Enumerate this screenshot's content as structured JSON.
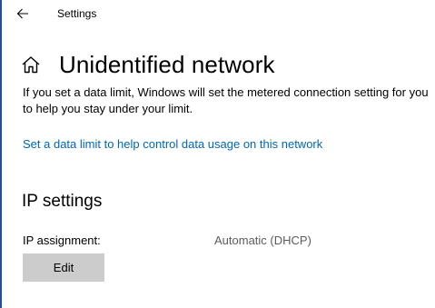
{
  "colors": {
    "accent": "#0067b8",
    "button_bg": "#cccccc",
    "window_edge": "#1e4fa3"
  },
  "titlebar": {
    "title": "Settings",
    "back_icon": "back-arrow-icon"
  },
  "header": {
    "icon": "home-icon",
    "title": "Unidentified network"
  },
  "description": "If you set a data limit, Windows will set the metered connection setting for you to help you stay under your limit.",
  "link": "Set a data limit to help control data usage on this network",
  "ip_settings": {
    "title": "IP settings",
    "assignment_label": "IP assignment:",
    "assignment_value": "Automatic (DHCP)",
    "edit_label": "Edit"
  }
}
